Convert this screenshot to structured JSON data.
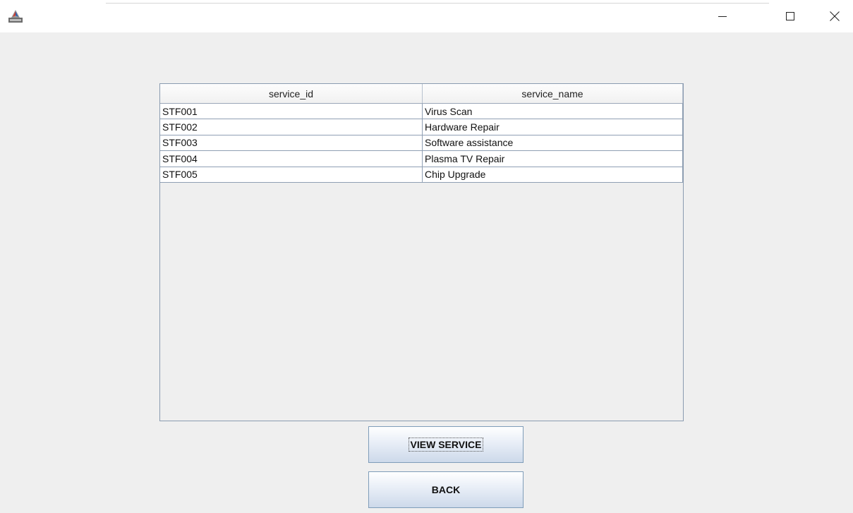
{
  "window": {
    "title": "",
    "controls": {
      "minimize_icon": "minimize-icon",
      "maximize_icon": "maximize-icon",
      "close_icon": "close-icon"
    }
  },
  "table": {
    "columns": [
      "service_id",
      "service_name"
    ],
    "rows": [
      [
        "STF001",
        "Virus Scan"
      ],
      [
        "STF002",
        "Hardware Repair"
      ],
      [
        "STF003",
        "Software assistance"
      ],
      [
        "STF004",
        "Plasma TV Repair"
      ],
      [
        "STF005",
        "Chip Upgrade"
      ]
    ]
  },
  "buttons": {
    "view_service": "VIEW SERVICE",
    "back": "BACK"
  },
  "colors": {
    "window_background": "#efefef",
    "titlebar_background": "#ffffff",
    "table_border": "#8f9fb3",
    "button_border": "#7f9db9"
  }
}
